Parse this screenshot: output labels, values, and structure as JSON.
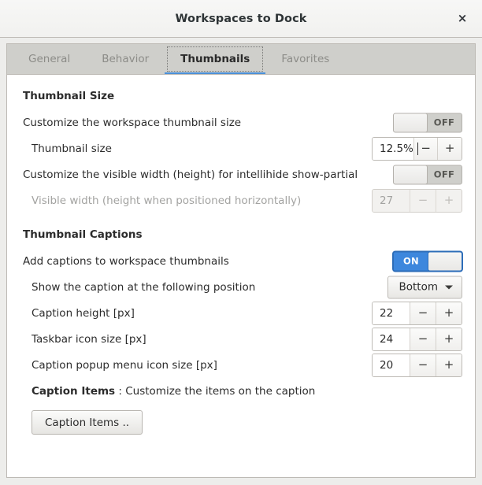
{
  "window": {
    "title": "Workspaces to Dock",
    "close_label": "×"
  },
  "tabs": [
    {
      "label": "General",
      "active": false
    },
    {
      "label": "Behavior",
      "active": false
    },
    {
      "label": "Thumbnails",
      "active": true
    },
    {
      "label": "Favorites",
      "active": false
    }
  ],
  "sections": {
    "thumbnail_size": {
      "heading": "Thumbnail Size",
      "customize_row": {
        "label": "Customize the workspace thumbnail size",
        "switch_state": "OFF"
      },
      "size_row": {
        "label": "Thumbnail size",
        "value": "12.5%",
        "minus": "−",
        "plus": "+"
      },
      "visible_width_row": {
        "label": "Customize the visible width (height) for intellihide show-partial",
        "switch_state": "OFF"
      },
      "visible_width_value_row": {
        "label": "Visible width (height when positioned horizontally)",
        "value": "27",
        "minus": "−",
        "plus": "+"
      }
    },
    "thumbnail_captions": {
      "heading": "Thumbnail Captions",
      "add_captions_row": {
        "label": "Add captions to workspace thumbnails",
        "switch_state": "ON"
      },
      "position_row": {
        "label": "Show the caption at the following position",
        "selected": "Bottom"
      },
      "caption_height_row": {
        "label": "Caption height [px]",
        "value": "22",
        "minus": "−",
        "plus": "+"
      },
      "taskbar_icon_row": {
        "label": "Taskbar icon size [px]",
        "value": "24",
        "minus": "−",
        "plus": "+"
      },
      "popup_icon_row": {
        "label": "Caption popup menu icon size [px]",
        "value": "20",
        "minus": "−",
        "plus": "+"
      },
      "caption_items_row": {
        "label_bold": "Caption Items",
        "label_rest": " : Customize the items on the caption"
      },
      "caption_items_button": "Caption Items .."
    }
  },
  "colors": {
    "accent": "#3d87dd",
    "tab_underline": "#4a90d9",
    "window_bg": "#ededeb",
    "page_bg": "#ffffff",
    "text": "#2c2c2c",
    "text_dim": "#a3a3a1"
  }
}
